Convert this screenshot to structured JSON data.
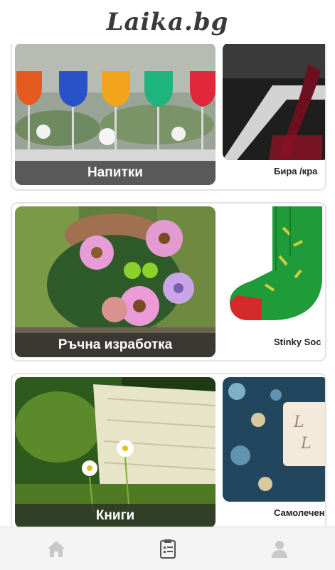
{
  "header": {
    "logo": "Laika.bg"
  },
  "cards": [
    {
      "main_label": "Напитки",
      "side_label": "Бира /кра"
    },
    {
      "main_label": "Ръчна изработка",
      "side_label": "Stinky Soc"
    },
    {
      "main_label": "Книги",
      "side_label": "Самолечение"
    }
  ],
  "nav": {
    "items": [
      "home-icon",
      "clipboard-icon",
      "user-icon"
    ],
    "active": "clipboard-icon"
  }
}
